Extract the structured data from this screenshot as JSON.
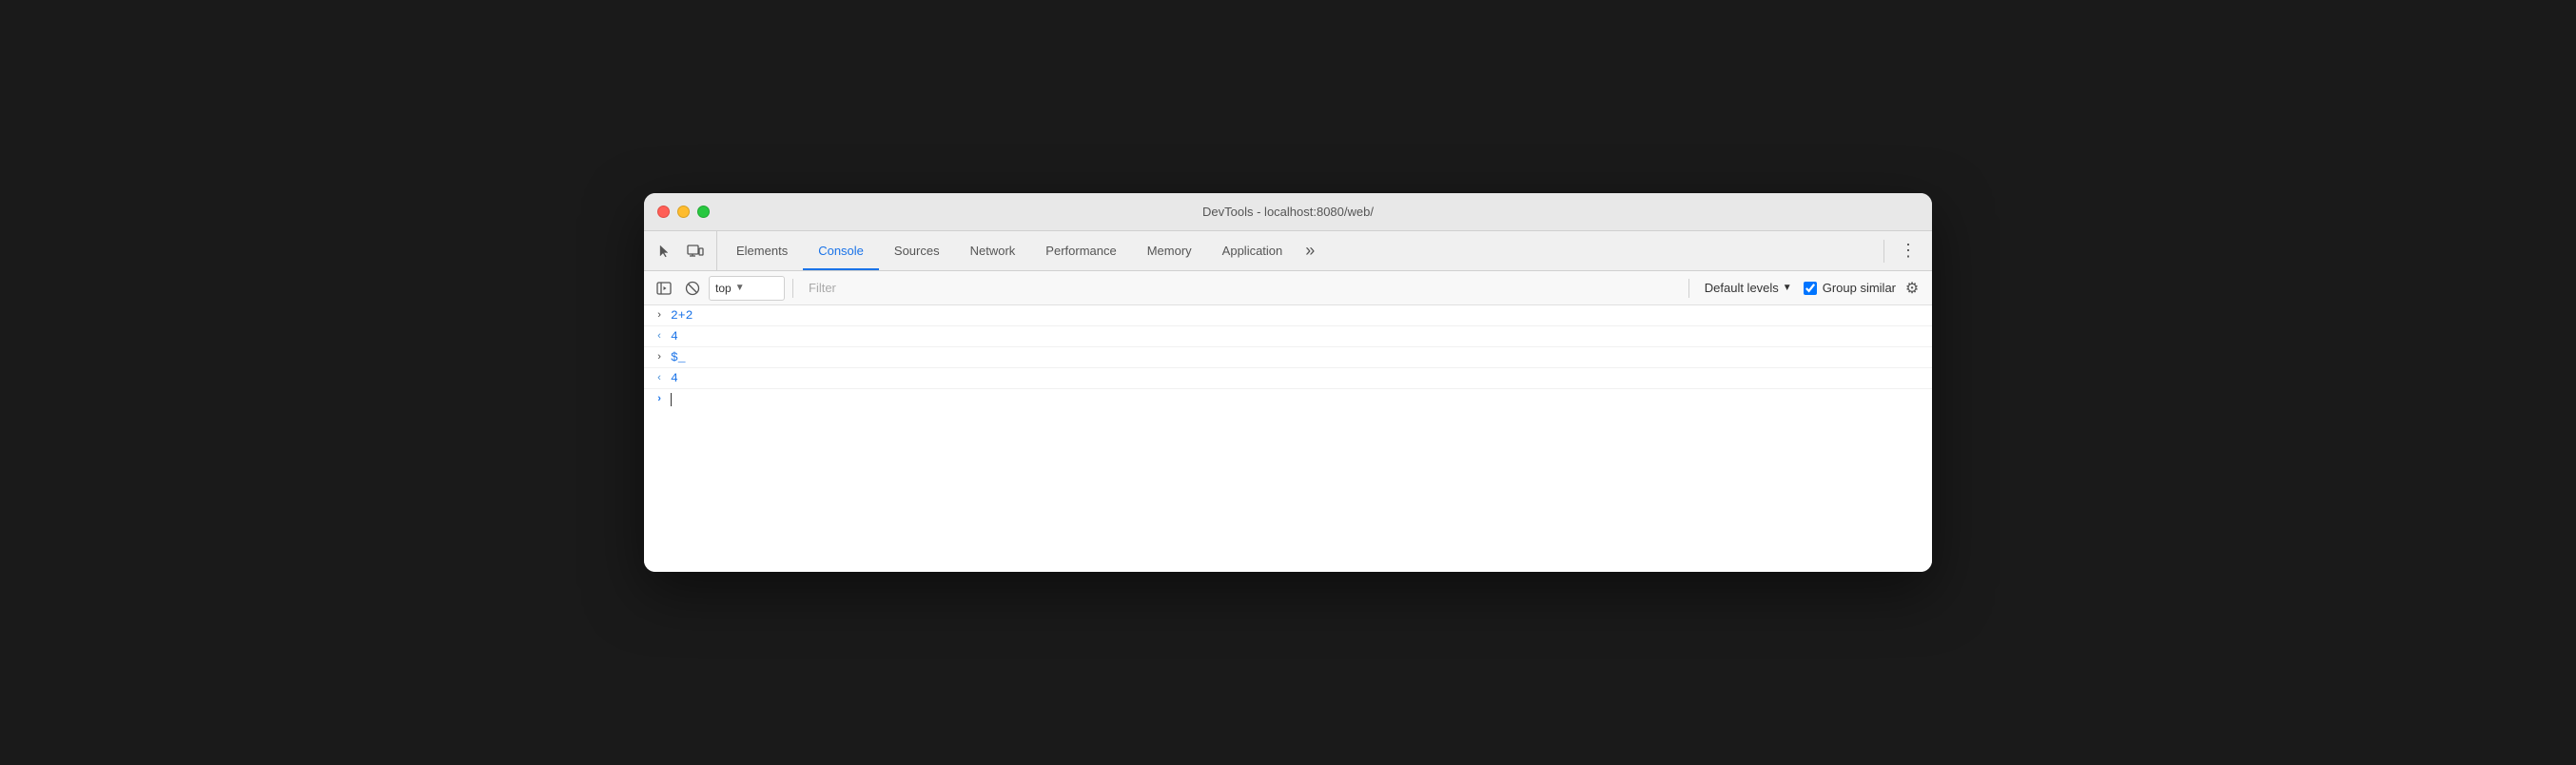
{
  "titlebar": {
    "title": "DevTools - localhost:8080/web/",
    "traffic_lights": [
      "red",
      "yellow",
      "green"
    ]
  },
  "tabs": {
    "items": [
      {
        "id": "elements",
        "label": "Elements",
        "active": false
      },
      {
        "id": "console",
        "label": "Console",
        "active": true
      },
      {
        "id": "sources",
        "label": "Sources",
        "active": false
      },
      {
        "id": "network",
        "label": "Network",
        "active": false
      },
      {
        "id": "performance",
        "label": "Performance",
        "active": false
      },
      {
        "id": "memory",
        "label": "Memory",
        "active": false
      },
      {
        "id": "application",
        "label": "Application",
        "active": false
      }
    ],
    "more_label": "»",
    "menu_label": "⋮"
  },
  "console_toolbar": {
    "context_value": "top",
    "filter_placeholder": "Filter",
    "levels_label": "Default levels",
    "group_similar_label": "Group similar",
    "group_similar_checked": true
  },
  "console_entries": [
    {
      "id": "entry-1",
      "chevron": ">",
      "chevron_dir": "right",
      "text": "2+2",
      "color": "blue"
    },
    {
      "id": "entry-2",
      "chevron": "<",
      "chevron_dir": "left",
      "text": "4",
      "color": "blue"
    },
    {
      "id": "entry-3",
      "chevron": ">",
      "chevron_dir": "right",
      "text": "$_",
      "color": "blue"
    },
    {
      "id": "entry-4",
      "chevron": "<",
      "chevron_dir": "left",
      "text": "4",
      "color": "blue"
    }
  ],
  "icons": {
    "cursor_icon": "cursor",
    "responsive_icon": "responsive",
    "no_entry_icon": "⊘",
    "sidebar_icon": "sidebar",
    "settings_gear": "⚙"
  }
}
